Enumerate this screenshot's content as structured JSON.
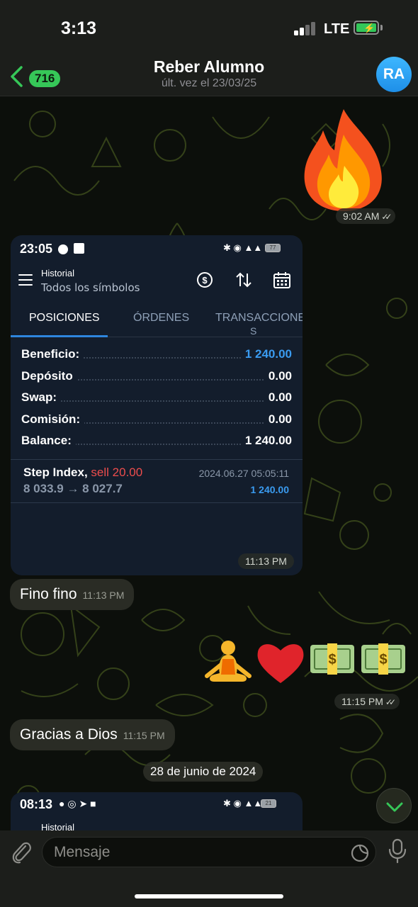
{
  "status_bar": {
    "time": "3:13",
    "network": "LTE"
  },
  "header": {
    "back_badge": "716",
    "title": "Reber Alumno",
    "subtitle": "últ. vez el 23/03/25",
    "avatar_initials": "RA"
  },
  "messages": {
    "fire_time": "9:02 AM",
    "screenshot1": {
      "time": "23:05",
      "battery": "77",
      "section": "Historial",
      "filter": "Todos los símbolos",
      "tabs": [
        "POSICIONES",
        "ÓRDENES",
        "TRANSACCIONE",
        "S"
      ],
      "rows": [
        {
          "label": "Beneficio:",
          "value": "1 240.00"
        },
        {
          "label": "Depósito",
          "value": "0.00"
        },
        {
          "label": "Swap:",
          "value": "0.00"
        },
        {
          "label": "Comisión:",
          "value": "0.00"
        },
        {
          "label": "Balance:",
          "value": "1 240.00"
        }
      ],
      "trade": {
        "symbol": "Step Index,",
        "side": "sell 20.00",
        "datetime": "2024.06.27 05:05:11",
        "prices": "8 033.9 → 8 027.7",
        "profit": "1 240.00"
      },
      "msg_time": "11:13 PM"
    },
    "fino": {
      "text": "Fino fino",
      "time": "11:13 PM"
    },
    "emojis_time": "11:15 PM",
    "gracias": {
      "text": "Gracias a Dios",
      "time": "11:15 PM"
    },
    "date_separator": "28 de junio de 2024",
    "screenshot2": {
      "time": "08:13",
      "section": "Historial",
      "battery": "21"
    }
  },
  "input": {
    "placeholder": "Mensaje"
  },
  "colors": {
    "accent": "#36c758",
    "blue": "#3a9bf0",
    "sell": "#ee4d4d"
  }
}
